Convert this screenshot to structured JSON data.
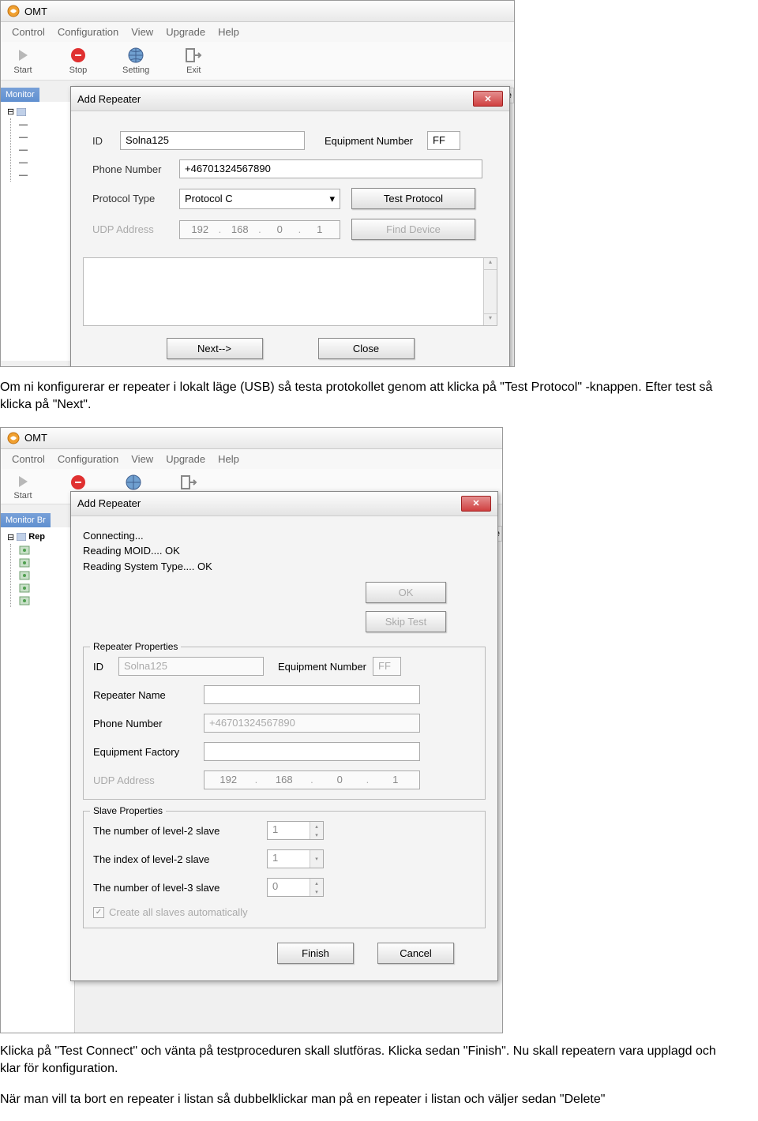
{
  "app": {
    "title": "OMT",
    "menu": [
      "Control",
      "Configuration",
      "View",
      "Upgrade",
      "Help"
    ],
    "toolbar": [
      {
        "label": "Start",
        "icon": "play"
      },
      {
        "label": "Stop",
        "icon": "stop"
      },
      {
        "label": "Setting",
        "icon": "globe"
      },
      {
        "label": "Exit",
        "icon": "exit"
      }
    ],
    "tree_tab": "Monitor Br",
    "tree_tab1": "Monitor",
    "tree_right_tab1": "te",
    "tree_right_tab2": "epe",
    "tree_root": "Rep"
  },
  "dialog1": {
    "title": "Add Repeater",
    "fields": {
      "id_label": "ID",
      "id_value": "Solna125",
      "equip_label": "Equipment Number",
      "equip_value": "FF",
      "phone_label": "Phone Number",
      "phone_value": "+46701324567890",
      "proto_label": "Protocol Type",
      "proto_value": "Protocol C",
      "test_btn": "Test Protocol",
      "udp_label": "UDP Address",
      "udp_ip": [
        "192",
        "168",
        "0",
        "1"
      ],
      "find_btn": "Find Device"
    },
    "buttons": {
      "next": "Next-->",
      "close": "Close"
    }
  },
  "para1": "Om ni konfigurerar er repeater i lokalt läge (USB) så testa protokollet genom att klicka på \"Test Protocol\" -knappen. Efter test så klicka på \"Next\".",
  "dialog2": {
    "title": "Add Repeater",
    "status": [
      "Connecting...",
      "Reading MOID.... OK",
      "Reading System Type.... OK"
    ],
    "ok_btn": "OK",
    "skip_btn": "Skip Test",
    "group1_title": "Repeater Properties",
    "rp": {
      "id_label": "ID",
      "id_value": "Solna125",
      "equip_label": "Equipment Number",
      "equip_value": "FF",
      "name_label": "Repeater Name",
      "phone_label": "Phone Number",
      "phone_value": "+46701324567890",
      "factory_label": "Equipment Factory",
      "udp_label": "UDP Address",
      "udp_ip": [
        "192",
        "168",
        "0",
        "1"
      ]
    },
    "group2_title": "Slave Properties",
    "sp": {
      "l2num_label": "The number of level-2 slave",
      "l2num_val": "1",
      "l2idx_label": "The index of level-2 slave",
      "l2idx_val": "1",
      "l3num_label": "The number of level-3 slave",
      "l3num_val": "0",
      "auto_label": "Create all slaves automatically"
    },
    "buttons": {
      "finish": "Finish",
      "cancel": "Cancel"
    }
  },
  "para2": "Klicka på \"Test Connect\" och vänta på testproceduren skall slutföras. Klicka sedan \"Finish\". Nu skall repeatern vara upplagd och klar för konfiguration.",
  "para3": "När man vill ta bort en repeater i listan så dubbelklickar man på en repeater i listan och väljer sedan \"Delete\""
}
